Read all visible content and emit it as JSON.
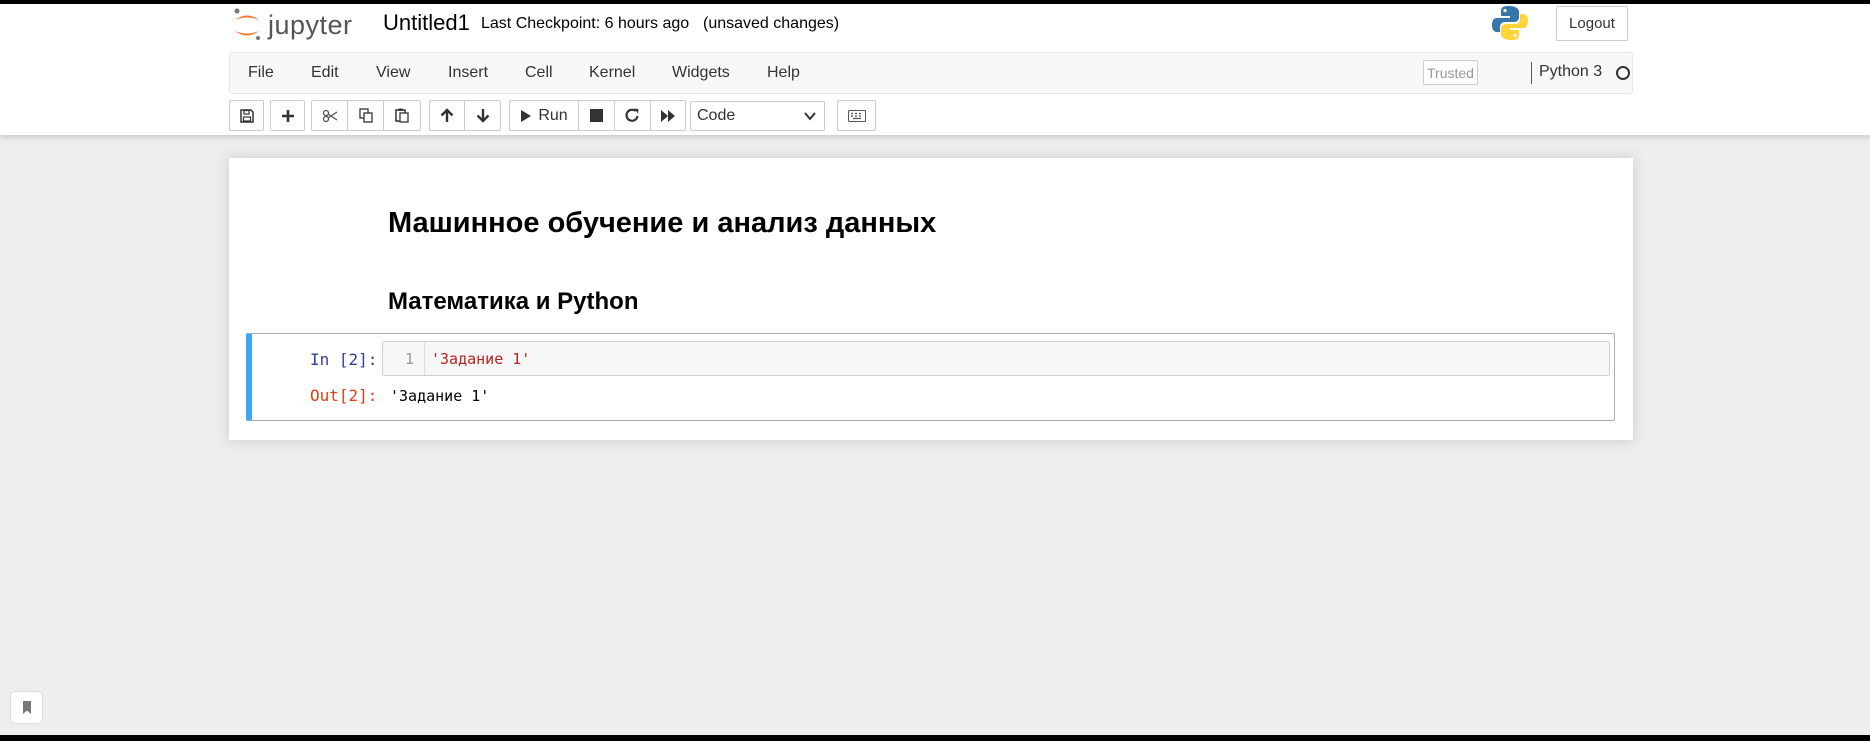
{
  "header": {
    "logo_text": "jupyter",
    "notebook_title": "Untitled1",
    "checkpoint": "Last Checkpoint: 6 hours ago",
    "autosave_status": "(unsaved changes)",
    "logout_label": "Logout"
  },
  "menubar": {
    "items": [
      "File",
      "Edit",
      "View",
      "Insert",
      "Cell",
      "Kernel",
      "Widgets",
      "Help"
    ],
    "trusted_label": "Trusted",
    "kernel_name": "Python 3"
  },
  "toolbar": {
    "run_label": "Run",
    "cell_type": "Code",
    "icons": [
      "save-icon",
      "plus-icon",
      "cut-icon",
      "copy-icon",
      "paste-icon",
      "arrow-up-icon",
      "arrow-down-icon",
      "play-icon",
      "stop-icon",
      "restart-icon",
      "fast-forward-icon",
      "keyboard-icon"
    ]
  },
  "notebook": {
    "heading1": "Машинное обучение и анализ данных",
    "heading2": "Математика и Python",
    "cell": {
      "in_prompt": "In [2]:",
      "line_number": "1",
      "code": "'Задание 1'",
      "out_prompt": "Out[2]:",
      "output": "'Задание 1'"
    }
  },
  "colors": {
    "selected_cell_bar": "#42a5f5",
    "in_prompt": "#303f9f",
    "out_prompt": "#d84315",
    "string_literal": "#ba2121",
    "jupyter_orange": "#f37726"
  }
}
